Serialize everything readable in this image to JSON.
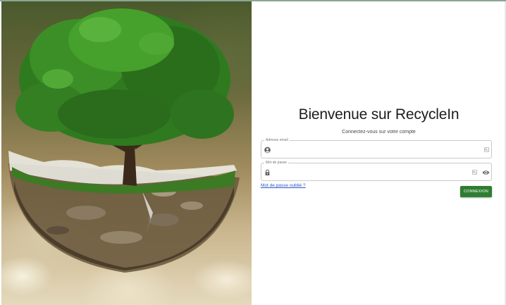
{
  "hero": {
    "icon": "tree-in-broken-globe-image"
  },
  "login": {
    "title": "Bienvenue sur RecycleIn",
    "subtitle": "Connectez-vous sur votre compte",
    "email_label": "Adresse email",
    "email_value": "",
    "password_label": "Mot de passe",
    "password_value": "",
    "forgot_link": "Mot de passe oublié ?",
    "submit_label": "CONNEXION"
  },
  "icons": {
    "email_lead": "account-circle-icon",
    "password_lead": "lock-icon",
    "autofill": "key-icon",
    "toggle_visibility": "eye-icon"
  },
  "colors": {
    "accent": "#2e7d32",
    "link": "#2a56c6"
  }
}
